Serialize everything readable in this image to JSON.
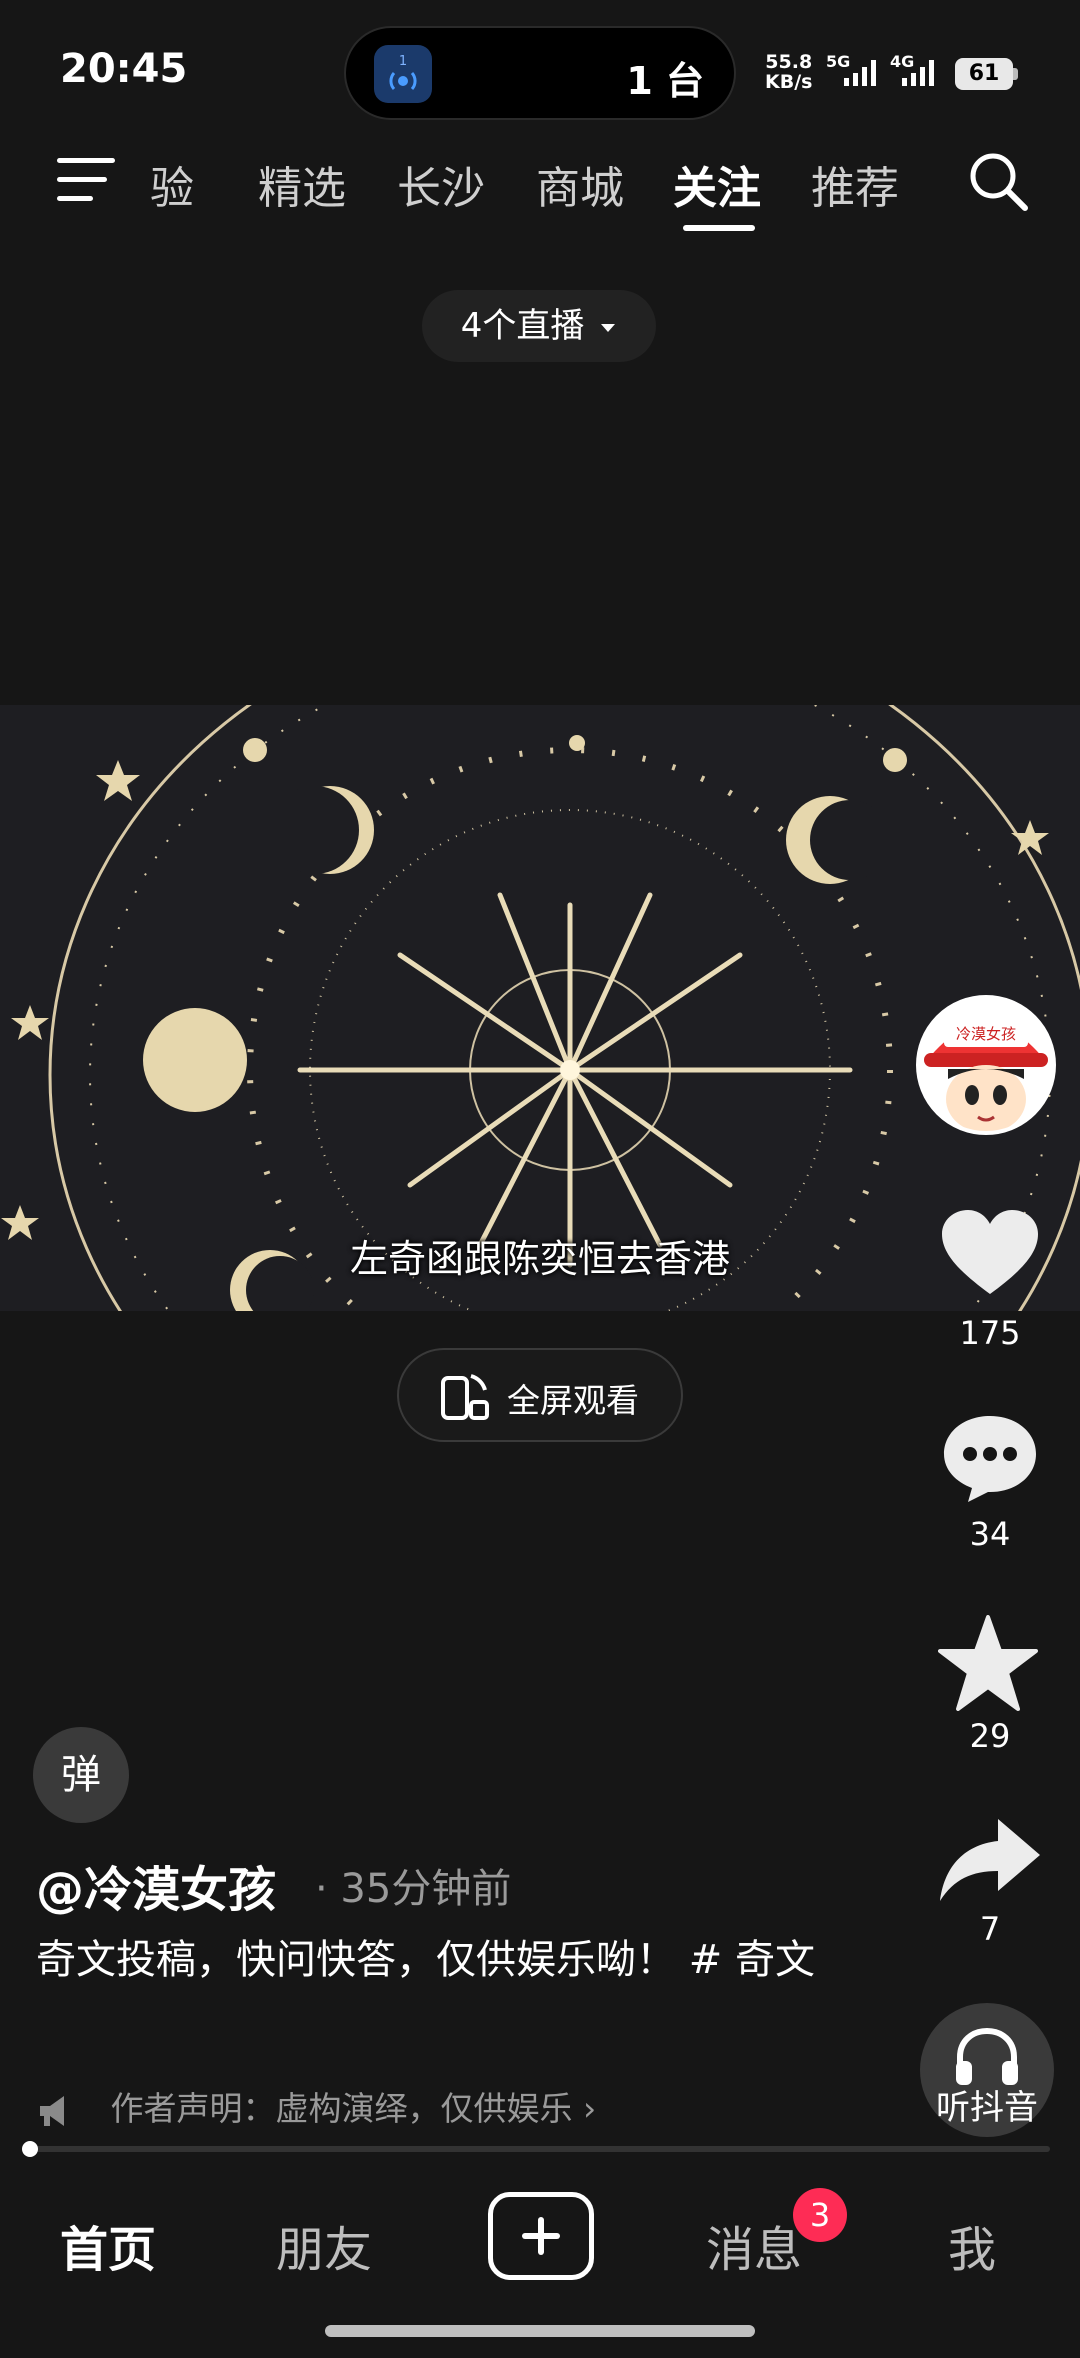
{
  "status_bar": {
    "time": "20:45",
    "island_app_number": "1",
    "island_text": "1 台",
    "net_speed_value": "55.8",
    "net_speed_unit": "KB/s",
    "signal1": "5G",
    "signal2": "4G",
    "battery": "61"
  },
  "top_nav": {
    "tabs": [
      {
        "label": "验"
      },
      {
        "label": "精选"
      },
      {
        "label": "长沙"
      },
      {
        "label": "商城"
      },
      {
        "label": "关注"
      },
      {
        "label": "推荐"
      }
    ],
    "active_tab": "关注"
  },
  "live_pill": "4个直播",
  "video": {
    "subtitle": "左奇函跟陈奕恒去香港"
  },
  "fullscreen_label": "全屏观看",
  "right_rail": {
    "avatar_text": "冷漠女孩",
    "likes": "175",
    "comments": "34",
    "favorites": "29",
    "shares": "7",
    "listen_label": "听抖音"
  },
  "caption": {
    "danmaku": "弹",
    "author": "@冷漠女孩",
    "time": "· 35分钟前",
    "description": "奇文投稿，快问快答，仅供娱乐呦！ # 奇文",
    "disclaimer": "作者声明：虚构演绎，仅供娱乐 ›"
  },
  "progress": 0.01,
  "bottom_nav": {
    "home": "首页",
    "friends": "朋友",
    "messages": "消息",
    "messages_badge": "3",
    "me": "我"
  },
  "colors": {
    "background": "#161616",
    "badge": "#fe2c55",
    "accent_blue": "#1677ff"
  },
  "icons": [
    "menu-icon",
    "search-icon",
    "caret-down-icon",
    "fullscreen-icon",
    "heart-icon",
    "comment-icon",
    "star-icon",
    "share-icon",
    "headphones-icon",
    "speaker-icon",
    "plus-icon"
  ]
}
